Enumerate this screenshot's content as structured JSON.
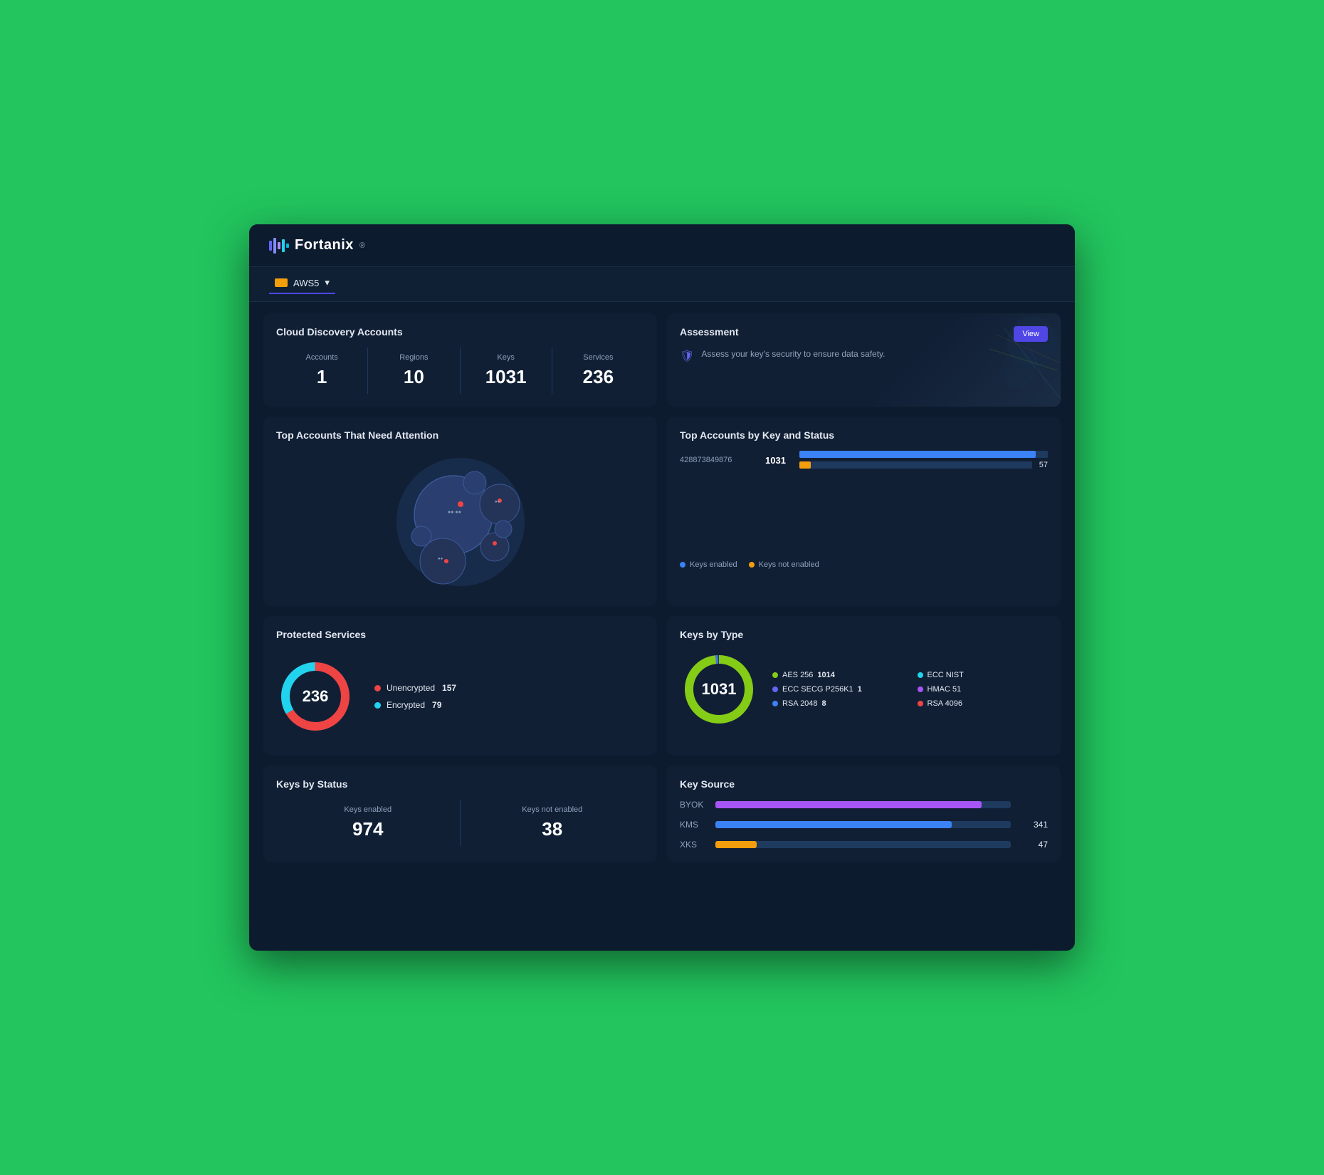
{
  "app": {
    "logo_text": "Fortanix",
    "logo_dot": "®"
  },
  "toolbar": {
    "aws_label": "AWS5",
    "dropdown_icon": "▾"
  },
  "cloud_discovery": {
    "title": "Cloud Discovery Accounts",
    "stats": [
      {
        "label": "Accounts",
        "value": "1"
      },
      {
        "label": "Regions",
        "value": "10"
      },
      {
        "label": "Keys",
        "value": "1031"
      },
      {
        "label": "Services",
        "value": "236"
      }
    ]
  },
  "assessment": {
    "title": "Assessment",
    "description": "Assess your key's security to ensure data safety.",
    "button_label": "View"
  },
  "top_accounts_attention": {
    "title": "Top Accounts That Need Attention"
  },
  "top_accounts_key": {
    "title": "Top Accounts by Key and Status",
    "accounts": [
      {
        "id": "428873849876",
        "keys": "1031",
        "enabled_pct": 95,
        "not_enabled_pct": 5,
        "not_enabled_val": "57"
      }
    ],
    "legend": [
      {
        "label": "Keys enabled",
        "color": "#3b82f6"
      },
      {
        "label": "Keys not enabled",
        "color": "#f59e0b"
      }
    ]
  },
  "protected_services": {
    "title": "Protected Services",
    "total": "236",
    "unencrypted": {
      "label": "Unencrypted",
      "value": "157",
      "color": "#ef4444"
    },
    "encrypted": {
      "label": "Encrypted",
      "value": "79",
      "color": "#22d3ee"
    }
  },
  "keys_by_type": {
    "title": "Keys by Type",
    "total": "1031",
    "types": [
      {
        "label": "AES 256",
        "value": "1014",
        "color": "#84cc16"
      },
      {
        "label": "ECC SECG P256K1",
        "value": "1",
        "color": "#6366f1"
      },
      {
        "label": "RSA 2048",
        "value": "8",
        "color": "#3b82f6"
      },
      {
        "label": "ECC NIST",
        "value": "",
        "color": "#22d3ee"
      },
      {
        "label": "HMAC 51",
        "value": "",
        "color": "#a855f7"
      },
      {
        "label": "RSA 4096",
        "value": "",
        "color": "#ef4444"
      }
    ]
  },
  "keys_by_status": {
    "title": "Keys by Status",
    "enabled_label": "Keys enabled",
    "enabled_value": "974",
    "not_enabled_label": "Keys not enabled",
    "not_enabled_value": "38"
  },
  "key_source": {
    "title": "Key Source",
    "sources": [
      {
        "label": "BYOK",
        "color": "#a855f7",
        "pct": 90,
        "count": ""
      },
      {
        "label": "KMS",
        "color": "#3b82f6",
        "pct": 80,
        "count": "341"
      },
      {
        "label": "XKS",
        "color": "#f59e0b",
        "pct": 14,
        "count": "47"
      }
    ]
  }
}
